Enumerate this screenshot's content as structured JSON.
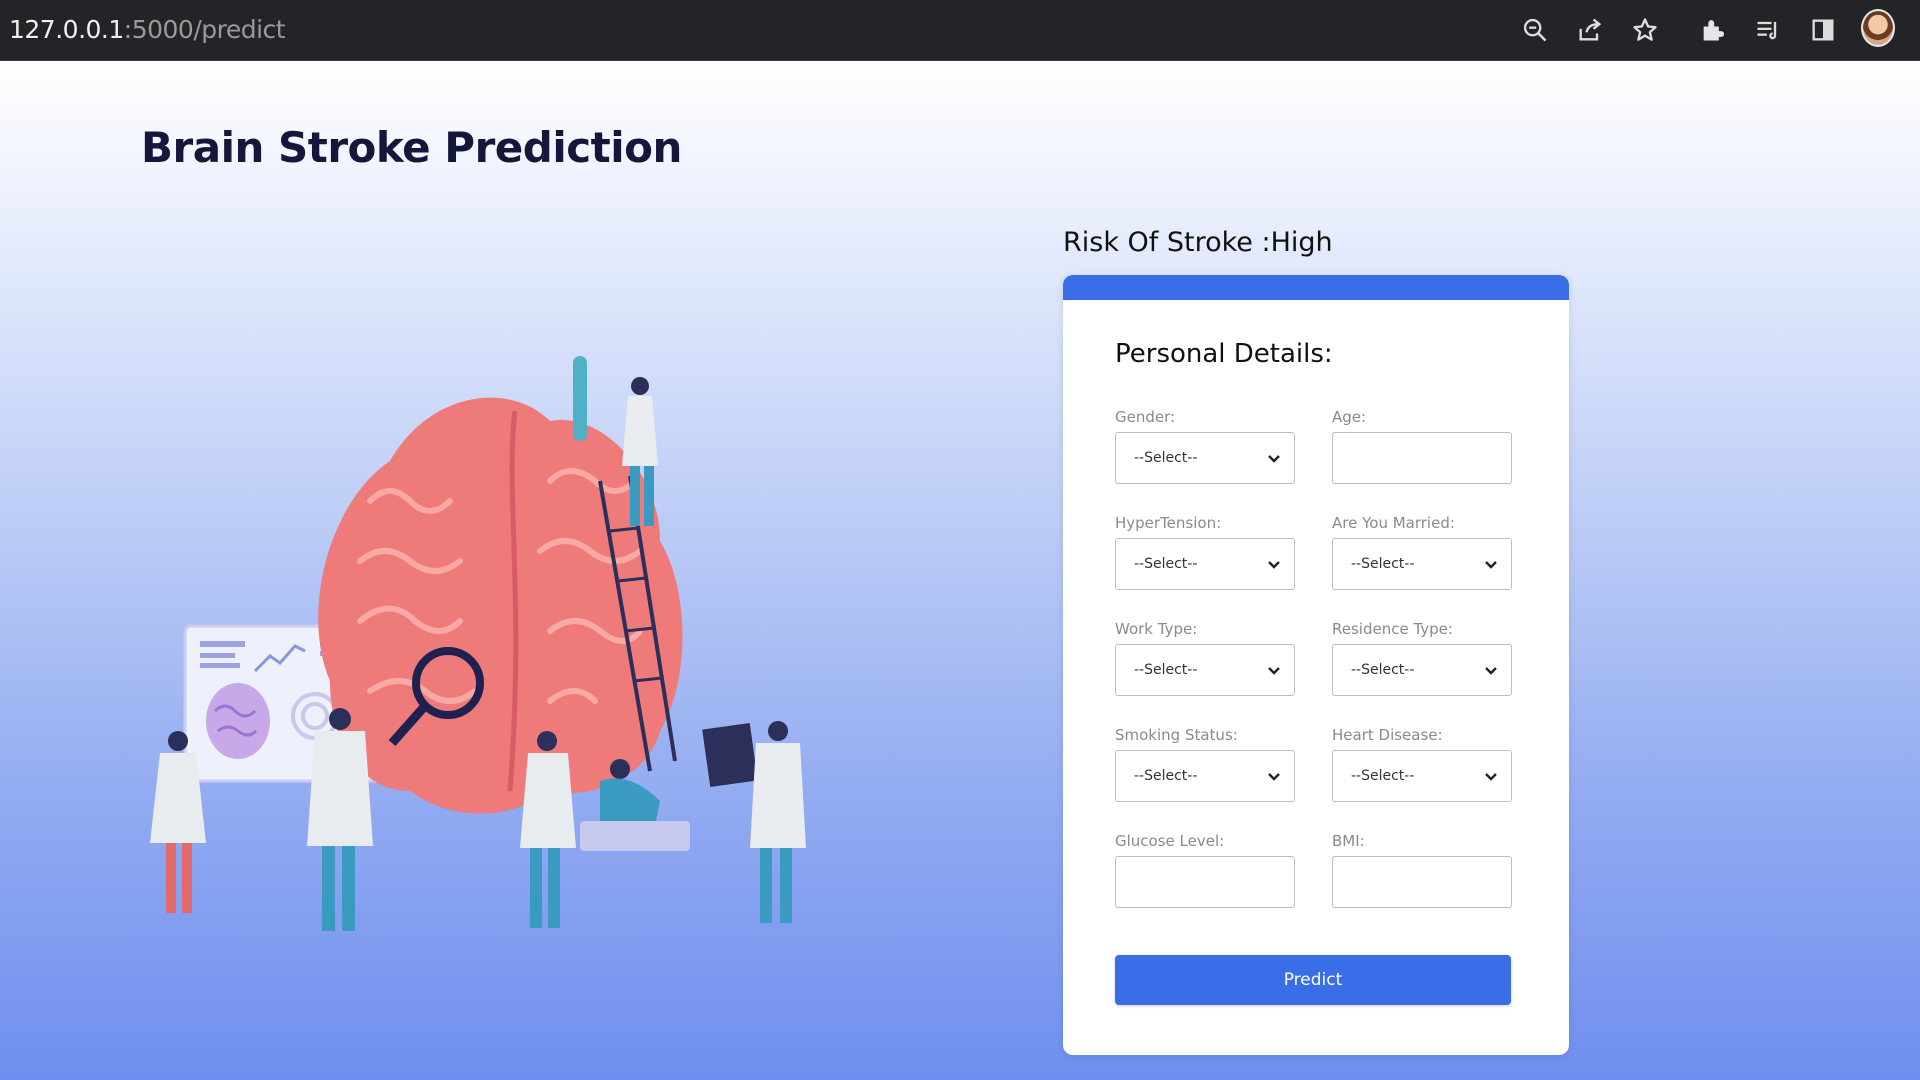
{
  "browser": {
    "url_host": "127.0.0.1",
    "url_path": ":5000/predict",
    "icons": [
      "zoom-icon",
      "share-icon",
      "star-icon",
      "extensions-icon",
      "reading-list-icon",
      "side-panel-icon",
      "profile-avatar"
    ]
  },
  "page": {
    "title": "Brain Stroke Prediction",
    "risk_text": "Risk Of Stroke :High"
  },
  "form": {
    "title": "Personal Details:",
    "fields": {
      "gender": {
        "label": "Gender:",
        "value": "--Select--"
      },
      "age": {
        "label": "Age:",
        "value": ""
      },
      "hypertension": {
        "label": "HyperTension:",
        "value": "--Select--"
      },
      "married": {
        "label": "Are You Married:",
        "value": "--Select--"
      },
      "work_type": {
        "label": "Work Type:",
        "value": "--Select--"
      },
      "residence_type": {
        "label": "Residence Type:",
        "value": "--Select--"
      },
      "smoking_status": {
        "label": "Smoking Status:",
        "value": "--Select--"
      },
      "heart_disease": {
        "label": "Heart Disease:",
        "value": "--Select--"
      },
      "glucose_level": {
        "label": "Glucose Level:",
        "value": ""
      },
      "bmi": {
        "label": "BMI:",
        "value": ""
      }
    },
    "submit_label": "Predict"
  },
  "colors": {
    "accent": "#3a6ee8",
    "title": "#14163a"
  }
}
